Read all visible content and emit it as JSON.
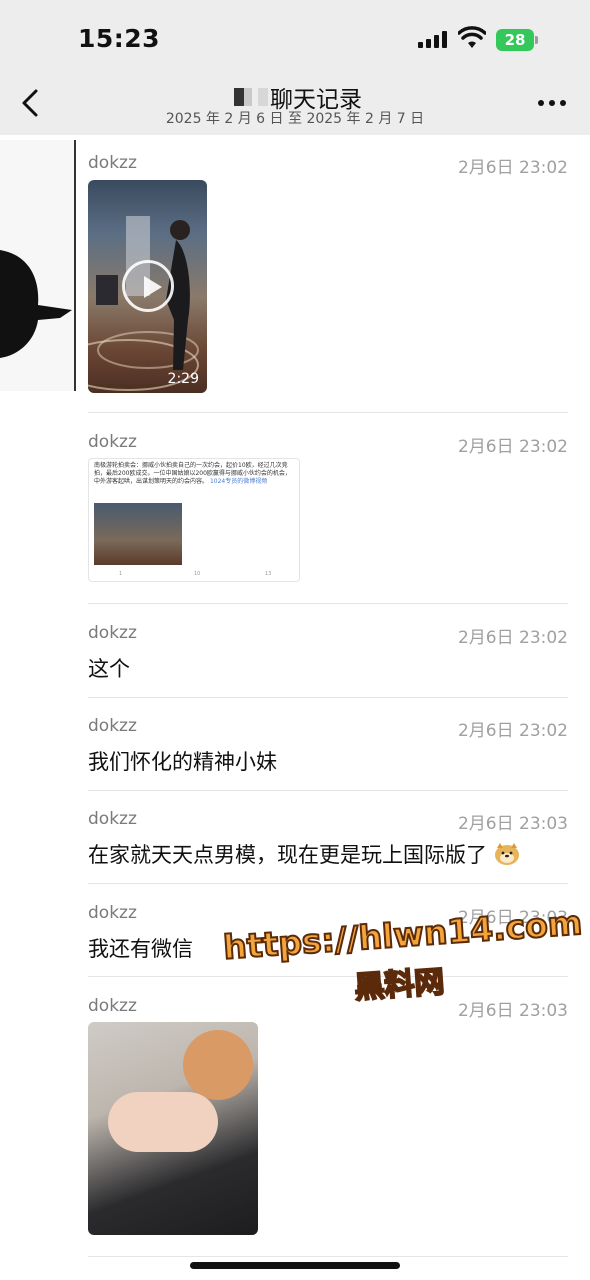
{
  "status_bar": {
    "time": "15:23",
    "battery": "28"
  },
  "header": {
    "title": "聊天记录",
    "date_range": "2025 年 2 月 6 日 至 2025 年 2 月 7 日"
  },
  "messages": [
    {
      "sender": "dokzz",
      "time": "2月6日 23:02",
      "type": "video",
      "duration": "2:29"
    },
    {
      "sender": "dokzz",
      "time": "2月6日 23:02",
      "type": "link_card",
      "card": {
        "text": "南极游轮拍卖会：挪威小伙拍卖自己的一次约会，起价10欧，经过几次竞拍，最后200欧成交。一位中国姑娘以200欧赢得与挪威小伙约会的机会，中外游客起哄，出谋划策明天的约会内容。",
        "link": "1024专员的微博视频",
        "footer": [
          "1",
          "10",
          "13"
        ]
      }
    },
    {
      "sender": "dokzz",
      "time": "2月6日 23:02",
      "type": "text",
      "text": "这个"
    },
    {
      "sender": "dokzz",
      "time": "2月6日 23:02",
      "type": "text",
      "text": "我们怀化的精神小妹"
    },
    {
      "sender": "dokzz",
      "time": "2月6日 23:03",
      "type": "text",
      "text": "在家就天天点男模，现在更是玩上国际版了"
    },
    {
      "sender": "dokzz",
      "time": "2月6日 23:03",
      "type": "text",
      "text": "我还有微信"
    },
    {
      "sender": "dokzz",
      "time": "2月6日 23:03",
      "type": "image"
    }
  ],
  "watermark": {
    "line1": "https://hlwn14.com",
    "line2": "黑料网"
  },
  "icons": [
    "back-chevron-icon",
    "more-dots-icon",
    "signal-icon",
    "wifi-icon",
    "battery-icon",
    "play-icon",
    "doge-emoji-icon"
  ]
}
